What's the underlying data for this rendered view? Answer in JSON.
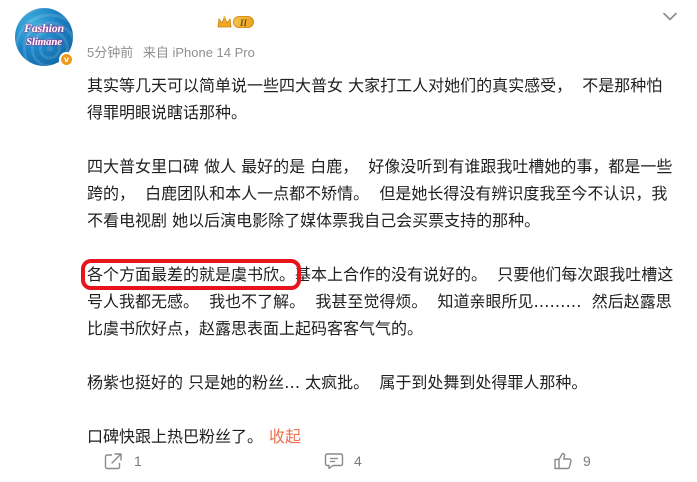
{
  "post": {
    "avatar": {
      "logo_line1": "Fashion",
      "logo_line2": "Slimane",
      "verified_icon": "v-badge-icon",
      "verified_color": "#f19a1b"
    },
    "user_level": "II",
    "meta": {
      "time": "5分钟前",
      "source": "来自 iPhone 14 Pro"
    },
    "paragraphs": {
      "p1": "其实等几天可以简单说一些四大普女 大家打工人对她们的真实感受，  不是那种怕得罪明眼说瞎话那种。",
      "p2": "四大普女里口碑 做人 最好的是 白鹿，  好像没听到有谁跟我吐槽她的事，都是一些跨的，  白鹿团队和本人一点都不矫情。  但是她长得没有辨识度我至今不认识，我不看电视剧 她以后演电影除了媒体票我自己会买票支持的那种。",
      "p3_highlight": "各个方面最差的就是虞书欣。",
      "p3_rest": "基本上合作的没有说好的。  只要他们每次跟我吐槽这号人我都无感。  我也不了解。  我甚至觉得烦。  知道亲眼所见………  然后赵露思比虞书欣好点，赵露思表面上起码客客气气的。",
      "p4": "杨紫也挺好的 只是她的粉丝… 太疯批。  属于到处舞到处得罪人那种。",
      "p5": "口碑快跟上热巴粉丝了。",
      "collapse_label": "收起"
    },
    "actions": {
      "share_count": "1",
      "comment_count": "4",
      "like_count": "9"
    },
    "colors": {
      "highlight_border": "#e8141c",
      "link": "#eb7350",
      "meta_text": "#8f8f8f"
    }
  }
}
